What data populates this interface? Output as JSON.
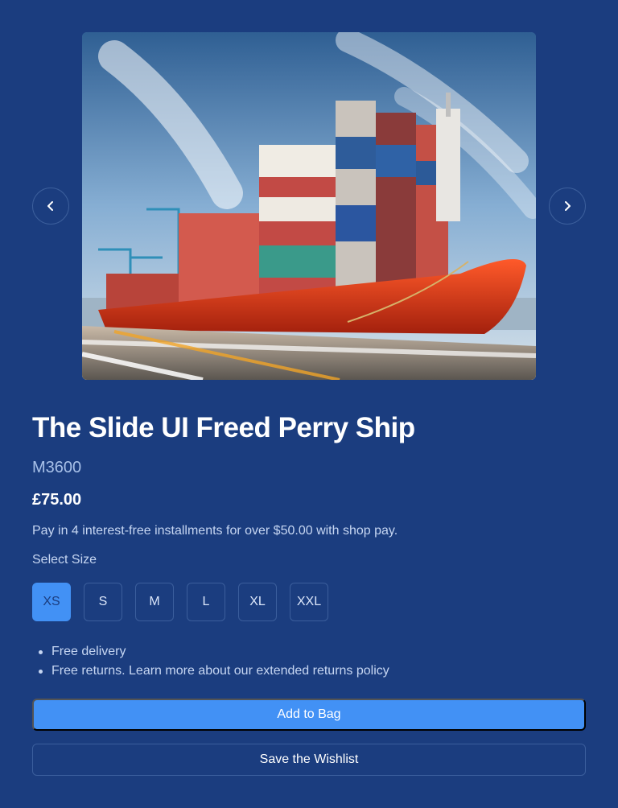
{
  "carousel": {
    "image_alt": "Red container ship loaded with shipping containers speeding past a port",
    "prev_icon": "chevron-left-icon",
    "next_icon": "chevron-right-icon"
  },
  "product": {
    "title": "The Slide UI Freed Perry Ship",
    "sku": "M3600",
    "price": "£75.00",
    "installments": "Pay in 4 interest-free installments for over $50.00 with shop pay."
  },
  "size_selector": {
    "label": "Select Size",
    "selected": "XS",
    "options": [
      "XS",
      "S",
      "M",
      "L",
      "XL",
      "XXL"
    ]
  },
  "features": [
    "Free delivery",
    "Free returns. Learn more about our extended returns policy"
  ],
  "actions": {
    "add_to_bag": "Add to Bag",
    "save_wishlist": "Save the Wishlist"
  },
  "colors": {
    "background": "#1b3d7f",
    "accent": "#4291f5",
    "border": "#3b5e9c"
  }
}
